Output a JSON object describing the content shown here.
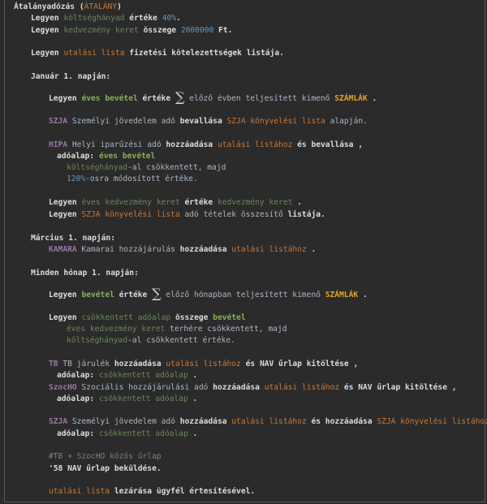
{
  "lines": [
    [
      [
        "k",
        "Átalányadózás ("
      ],
      [
        "o",
        "ÁTALÁNY"
      ],
      [
        "k",
        ")"
      ]
    ],
    [
      [
        "k",
        "Legyen "
      ],
      [
        "g",
        "költséghányad"
      ],
      [
        "k",
        " értéke "
      ],
      [
        "b",
        "40%"
      ],
      [
        "k",
        "."
      ]
    ],
    [
      [
        "k",
        "Legyen "
      ],
      [
        "g",
        "kedvezmény keret"
      ],
      [
        "k",
        " összege "
      ],
      [
        "b",
        "2000000"
      ],
      [
        "k",
        " Ft."
      ]
    ],
    [
      [
        "k",
        "Legyen "
      ],
      [
        "o",
        "utalási lista"
      ],
      [
        "k",
        " fizetési kötelezettségek listája."
      ]
    ],
    [
      [
        "k",
        "Január 1. napján:"
      ]
    ],
    [
      [
        "k",
        "Legyen "
      ],
      [
        "G",
        "éves bevétel"
      ],
      [
        "k",
        " értéke "
      ],
      [
        "sig",
        "∑"
      ],
      [
        "n",
        " előző évben teljesített kimenő "
      ],
      [
        "y",
        "SZÁMLÁK"
      ],
      [
        "k",
        " ."
      ]
    ],
    [
      [
        "p",
        "SZJA"
      ],
      [
        "n",
        " Személyi jövedelem adó "
      ],
      [
        "k",
        "bevallása "
      ],
      [
        "o",
        "SZJA könyvelési lista"
      ],
      [
        "n",
        " alapján."
      ]
    ],
    [
      [
        "p",
        "HIPA"
      ],
      [
        "n",
        " Helyi iparűzési adó "
      ],
      [
        "k",
        "hozzáadása "
      ],
      [
        "o",
        "utalási listához"
      ],
      [
        "k",
        " és bevallása ,"
      ]
    ],
    [
      [
        "k",
        "adóalap: "
      ],
      [
        "G",
        "éves bevétel"
      ]
    ],
    [
      [
        "g",
        "költséghányad"
      ],
      [
        "n",
        "-al csökkentett, majd"
      ]
    ],
    [
      [
        "b",
        "120%"
      ],
      [
        "n",
        "-osra módosított értéke."
      ]
    ],
    [
      [
        "k",
        "Legyen "
      ],
      [
        "g",
        "éves kedvezmény keret"
      ],
      [
        "k",
        " értéke "
      ],
      [
        "g",
        "kedvezmény keret"
      ],
      [
        "k",
        " ."
      ]
    ],
    [
      [
        "k",
        "Legyen "
      ],
      [
        "o",
        "SZJA könyvelési lista"
      ],
      [
        "n",
        " adó tételek összesítő "
      ],
      [
        "k",
        "listája."
      ]
    ],
    [
      [
        "k",
        "Március 1. napján:"
      ]
    ],
    [
      [
        "p",
        "KAMARA"
      ],
      [
        "n",
        " Kamarai hozzájárulás "
      ],
      [
        "k",
        "hozzáadása "
      ],
      [
        "o",
        "utalási listához"
      ],
      [
        "k",
        " ."
      ]
    ],
    [
      [
        "k",
        "Minden hónap 1. napján:"
      ]
    ],
    [
      [
        "k",
        "Legyen "
      ],
      [
        "G",
        "bevétel"
      ],
      [
        "k",
        " értéke "
      ],
      [
        "sig",
        "∑"
      ],
      [
        "n",
        " előző hónapban teljesített kimenő "
      ],
      [
        "y",
        "SZÁMLÁK"
      ],
      [
        "k",
        " ."
      ]
    ],
    [
      [
        "k",
        "Legyen "
      ],
      [
        "g",
        "csökkentett adóalap"
      ],
      [
        "k",
        " összege "
      ],
      [
        "G",
        "bevétel"
      ]
    ],
    [
      [
        "g",
        "éves kedvezmény keret"
      ],
      [
        "n",
        " terhére csökkentett, majd"
      ]
    ],
    [
      [
        "g",
        "költséghányad"
      ],
      [
        "n",
        "-al csökkentett értéke."
      ]
    ],
    [
      [
        "p",
        "TB"
      ],
      [
        "n",
        " TB járulék "
      ],
      [
        "k",
        "hozzáadása "
      ],
      [
        "o",
        "utalási listához"
      ],
      [
        "k",
        " és NAV űrlap kitöltése ,"
      ]
    ],
    [
      [
        "k",
        "adóalap: "
      ],
      [
        "g",
        "csökkentett adóalap"
      ],
      [
        "k",
        " ."
      ]
    ],
    [
      [
        "p",
        "SzocHO"
      ],
      [
        "n",
        " Szociális hozzájárulási adó "
      ],
      [
        "k",
        "hozzáadása "
      ],
      [
        "o",
        "utalási listához"
      ],
      [
        "k",
        " és NAV űrlap kitöltése ,"
      ]
    ],
    [
      [
        "k",
        "adóalap: "
      ],
      [
        "g",
        "csökkentett adóalap"
      ],
      [
        "k",
        " ."
      ]
    ],
    [
      [
        "p",
        "SZJA"
      ],
      [
        "n",
        " Személyi jövedelem adó "
      ],
      [
        "k",
        "hozzáadása "
      ],
      [
        "o",
        "utalási listához"
      ],
      [
        "k",
        " és hozzáadása "
      ],
      [
        "o",
        "SZJA könyvelési listához"
      ],
      [
        "k",
        ","
      ]
    ],
    [
      [
        "k",
        "adóalap: "
      ],
      [
        "g",
        "csökkentett adóalap"
      ],
      [
        "k",
        " ."
      ]
    ],
    [
      [
        "c",
        "#TB + SzocHO közös űrlap"
      ]
    ],
    [
      [
        "k",
        "'58 NAV űrlap beküldése."
      ]
    ],
    [
      [
        "o",
        "utalási lista"
      ],
      [
        "k",
        " lezárása ügyfél értesítésével."
      ]
    ]
  ]
}
